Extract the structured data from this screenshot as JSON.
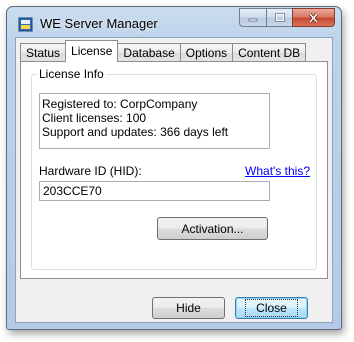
{
  "window": {
    "title": "WE Server Manager",
    "icon": "app-icon",
    "caption_icons": [
      "minimize-icon",
      "maximize-icon",
      "close-icon"
    ]
  },
  "tabs": [
    {
      "label": "Status"
    },
    {
      "label": "License",
      "active": true
    },
    {
      "label": "Database"
    },
    {
      "label": "Options"
    },
    {
      "label": "Content DB"
    }
  ],
  "license": {
    "group_title": "License Info",
    "info_lines": [
      "Registered to: CorpCompany",
      "Client licenses: 100",
      "Support and updates: 366 days left"
    ],
    "hid_label": "Hardware ID (HID):",
    "whats_this": "What's this?",
    "hid_value": "203CCE70",
    "activation_label": "Activation..."
  },
  "footer": {
    "hide_label": "Hide",
    "close_label": "Close"
  },
  "colors": {
    "frame": "#bcd2ea",
    "link": "#0000ff",
    "default_button_border": "#3c7fb1"
  }
}
